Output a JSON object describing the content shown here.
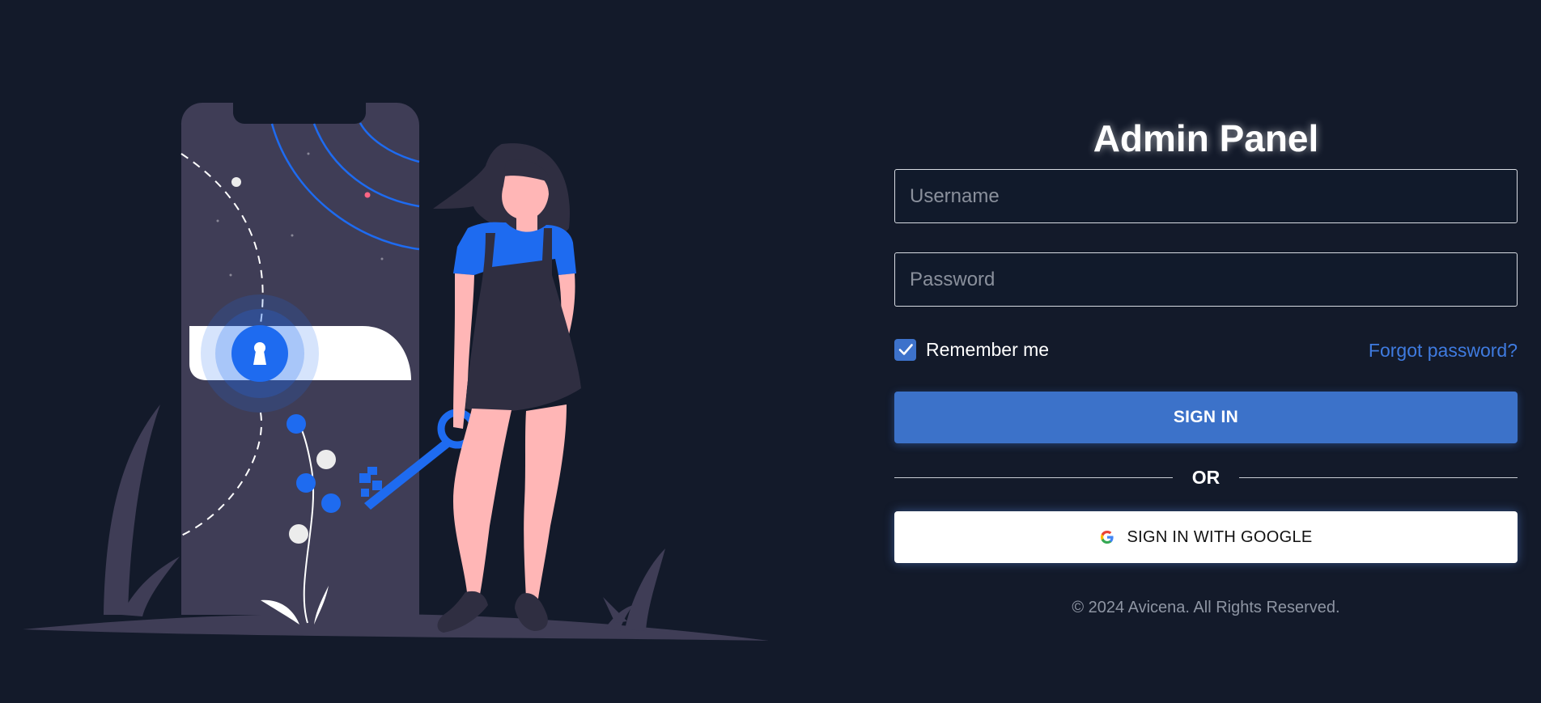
{
  "login": {
    "title": "Admin Panel",
    "username_placeholder": "Username",
    "password_placeholder": "Password",
    "remember_label": "Remember me",
    "remember_checked": true,
    "forgot_link": "Forgot password?",
    "signin_label": "SIGN IN",
    "divider_label": "OR",
    "google_label": "SIGN IN WITH GOOGLE",
    "footer": "© 2024 Avicena. All Rights Reserved."
  },
  "icons": {
    "checkbox": "checkmark-icon",
    "google": "google-g-icon",
    "lock": "keyhole-icon"
  },
  "colors": {
    "background": "#131a2a",
    "primary": "#3c72c9",
    "link": "#3f7be0",
    "accent_blue": "#1e6bf0",
    "phone": "#3f3d56"
  }
}
